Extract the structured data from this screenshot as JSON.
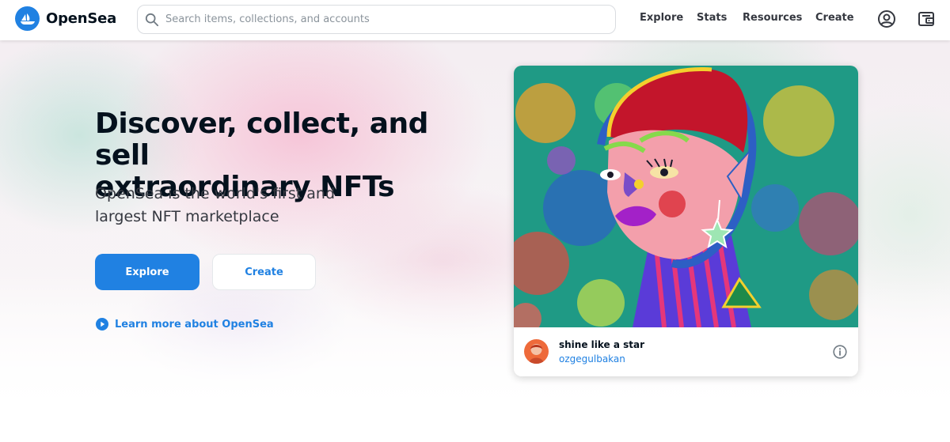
{
  "brand": {
    "name": "OpenSea",
    "accent": "#2081e2",
    "text_dark": "#04111d"
  },
  "search": {
    "placeholder": "Search items, collections, and accounts",
    "value": ""
  },
  "nav": {
    "items": [
      {
        "label": "Explore"
      },
      {
        "label": "Stats"
      },
      {
        "label": "Resources"
      },
      {
        "label": "Create"
      }
    ],
    "icons": [
      "account-icon",
      "wallet-icon"
    ]
  },
  "hero": {
    "headline_line1": "Discover, collect, and sell",
    "headline_line2": "extraordinary NFTs",
    "subhead_line1": "OpenSea is the world's first and",
    "subhead_line2": "largest NFT marketplace",
    "primary_button": "Explore",
    "secondary_button": "Create",
    "learn_more": "Learn more about OpenSea"
  },
  "featured": {
    "title": "shine like a star",
    "creator": "ozgegulbakan",
    "icons": [
      "info-icon"
    ]
  }
}
